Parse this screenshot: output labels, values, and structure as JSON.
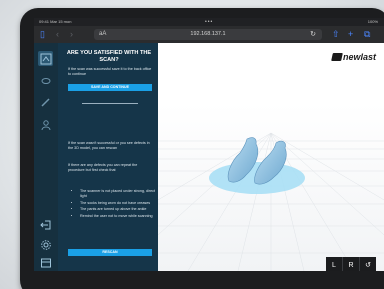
{
  "status_bar": {
    "time": "09:41 Mar 15 mon",
    "dots": "•••",
    "battery": "100%"
  },
  "browser": {
    "text_size": "aA",
    "url": "192.168.137.1",
    "icons": [
      "sidebar-icon",
      "back-icon",
      "forward-icon",
      "reload-icon",
      "share-icon",
      "new-tab-icon",
      "tabs-icon"
    ]
  },
  "scan_panel": {
    "title": "ARE YOU SATISFIED WITH THE SCAN?",
    "success_text": "If the scan was successful save it to the back office to continue",
    "save_label": "SAVE AND CONTINUE",
    "fail_text": "If the scan wasn't successful or you see defects in the 3D model, you can rescan",
    "defects_text": "If there are any defects you can repeat the procedure but first check that",
    "checklist": [
      "The scanner is not placed under strong, direct light",
      "The socks being worn do not have creases",
      "The pants are turned up above the ankle",
      "Remind the user not to move while scanning"
    ],
    "rescan_label": "RESCAN"
  },
  "viewer": {
    "brand": "newlast",
    "left_label": "L",
    "right_label": "R"
  },
  "colors": {
    "panel": "#153549",
    "iconbar": "#16303f",
    "accent": "#1aa0e6",
    "foot": "#8ec6e8",
    "platform": "#a9dff5"
  }
}
